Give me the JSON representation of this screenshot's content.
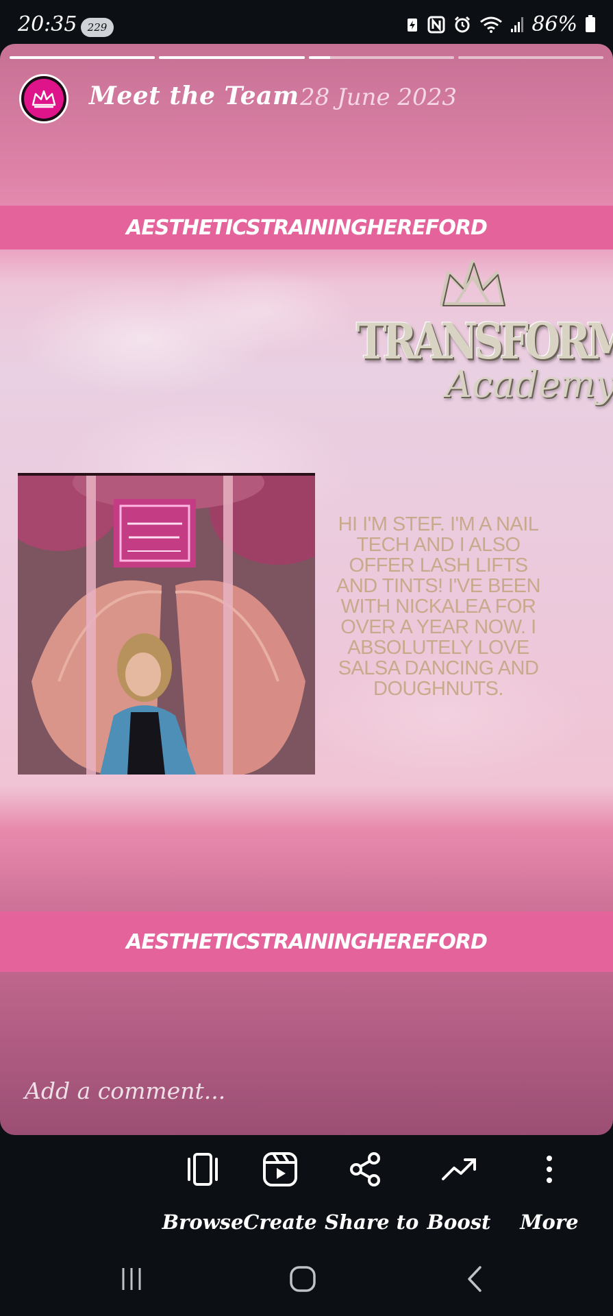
{
  "status_bar": {
    "time": "20:35",
    "notification_count": "229",
    "battery": "86%",
    "icons": [
      "battery-saver-icon",
      "nfc-icon",
      "alarm-icon",
      "wifi-icon",
      "signal-icon",
      "battery-icon"
    ]
  },
  "story": {
    "progress_segments": [
      1,
      1,
      0.15,
      0
    ],
    "account_title": "Meet the Team",
    "date": "28 June 2023",
    "banner_top": "AESTHETICSTRAININGHEREFORD",
    "banner_bottom": "AESTHETICSTRAININGHEREFORD",
    "logo_text": "TRANSFORMED",
    "logo_subtext": "Academy",
    "body_text": "HI I'M STEF. I'M A NAIL TECH AND I ALSO OFFER LASH LIFTS AND TINTS! I'VE BEEN WITH NICKALEA FOR OVER A YEAR NOW. I ABSOLUTELY LOVE SALSA DANCING AND DOUGHNUTS.",
    "comment_placeholder": "Add a comment..."
  },
  "actions": [
    {
      "label": "Browse",
      "icon": "browse-icon"
    },
    {
      "label": "Create",
      "icon": "create-reel-icon"
    },
    {
      "label": "Share to",
      "icon": "share-icon"
    },
    {
      "label": "Boost",
      "icon": "boost-icon"
    },
    {
      "label": "More",
      "icon": "more-icon"
    }
  ],
  "nav": [
    "recents-icon",
    "home-icon",
    "back-icon"
  ],
  "colors": {
    "banner": "#e3639a",
    "story_text": "#c9a98c",
    "avatar_ring": "#e0148a",
    "background": "#0c0f14"
  }
}
